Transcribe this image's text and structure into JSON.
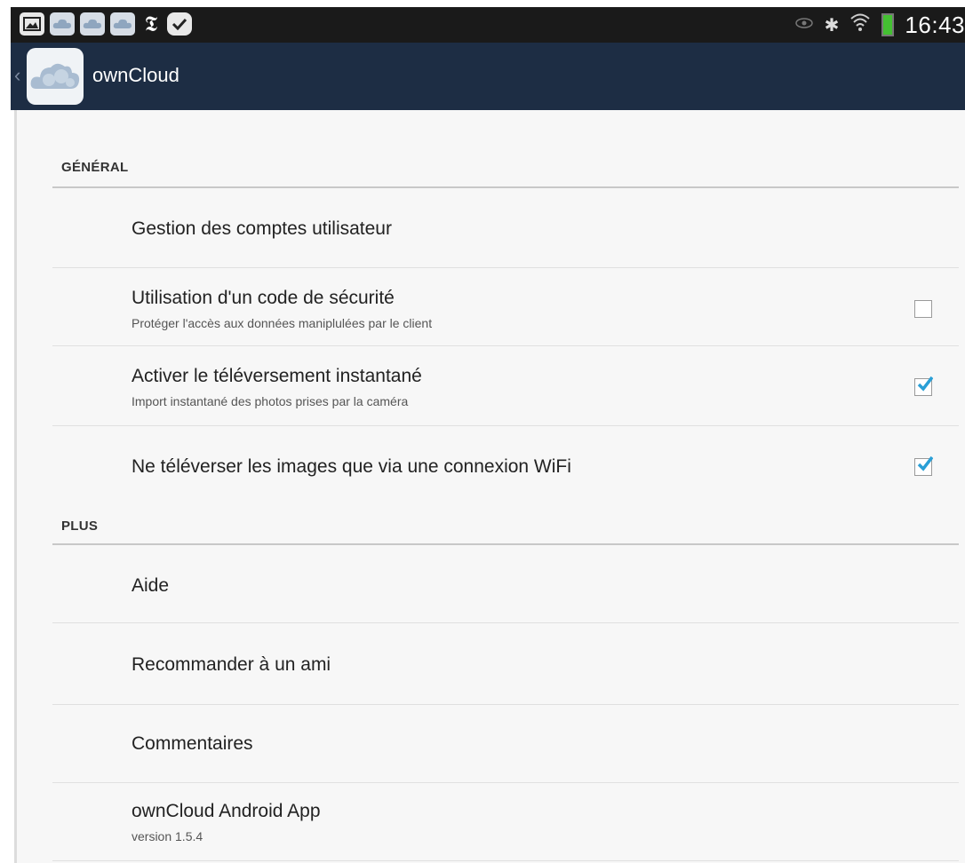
{
  "status_bar": {
    "notification_icons": [
      "gallery-icon",
      "cloud-icon",
      "cloud-icon",
      "cloud-icon",
      "nyt-icon",
      "check-icon"
    ],
    "nyt_glyph": "𝕿",
    "right_icons": [
      "eye-icon",
      "bluetooth-icon",
      "wifi-icon",
      "battery-icon"
    ],
    "bluetooth_glyph": "✱",
    "wifi_glyph": "≋",
    "time": "16:43"
  },
  "action_bar": {
    "back_glyph": "‹",
    "title": "ownCloud"
  },
  "sections": {
    "general": {
      "header": "GÉNÉRAL",
      "items": [
        {
          "title": "Gestion des comptes utilisateur"
        },
        {
          "title": "Utilisation d'un code de sécurité",
          "summary": "Protéger l'accès aux données maniplulées par le client",
          "checked": false
        },
        {
          "title": "Activer le téléversement instantané",
          "summary": "Import instantané des photos prises par la caméra",
          "checked": true
        },
        {
          "title": "Ne téléverser les images que via une connexion WiFi",
          "checked": true
        }
      ]
    },
    "plus": {
      "header": "PLUS",
      "items": [
        {
          "title": "Aide"
        },
        {
          "title": "Recommander à un ami"
        },
        {
          "title": "Commentaires"
        },
        {
          "title": "ownCloud Android App",
          "summary": "version 1.5.4"
        }
      ]
    }
  },
  "colors": {
    "action_bar": "#1d2d44",
    "status_bar": "#1a1a1a",
    "checkbox_check": "#2a9fd6",
    "battery": "#44c032"
  }
}
